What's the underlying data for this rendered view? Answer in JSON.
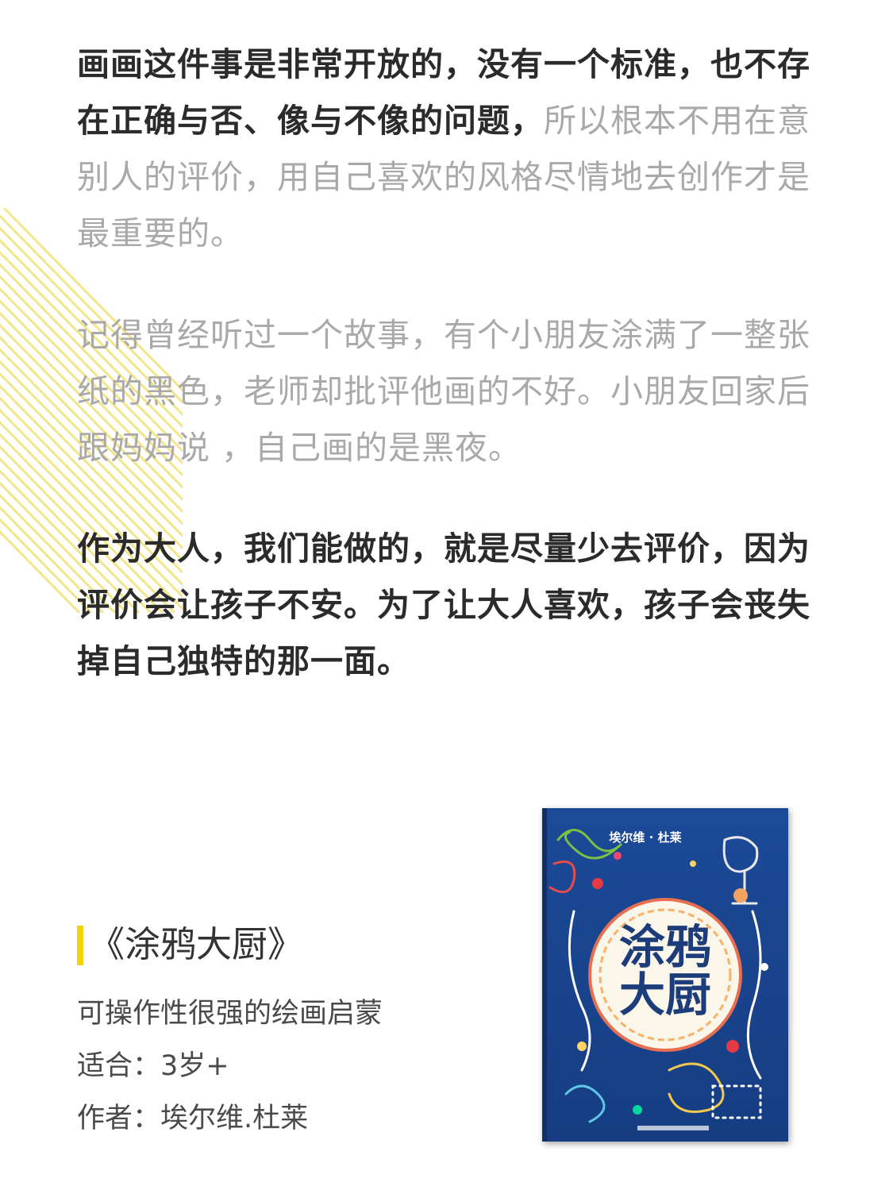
{
  "paragraphs": [
    {
      "bold_text": "画画这件事是非常开放的，没有一个标准，也不存在正确与否、像与不像的问题，",
      "gray_text": "所以根本不用在意别人的评价，用自己喜欢的风格尽情地去创作才是最重要的。"
    },
    {
      "gray_text": "记得曾经听过一个故事，有个小朋友涂满了一整张纸的黑色，老师却批评他画的不好。小朋友回家后跟妈妈说 ，自己画的是黑夜。"
    },
    {
      "bold_text": "作为大人，我们能做的，就是尽量少去评价，因为评价会让孩子不安。为了让大人喜欢，孩子会丧失掉自己独特的那一面。"
    }
  ],
  "book": {
    "title": "《涂鸦大厨》",
    "subtitle": "可操作性很强的绘画启蒙",
    "age": "适合：3岁+",
    "author": "作者：埃尔维.杜莱",
    "cover": {
      "author_label": "埃尔维 · 杜莱",
      "title_line1": "涂鸦",
      "title_line2": "大厨"
    }
  },
  "colors": {
    "accent_yellow": "#f5d20a",
    "bold_text": "#2b2b2b",
    "gray_text": "#a9a9a9",
    "cover_blue": "#1f4f9c"
  }
}
